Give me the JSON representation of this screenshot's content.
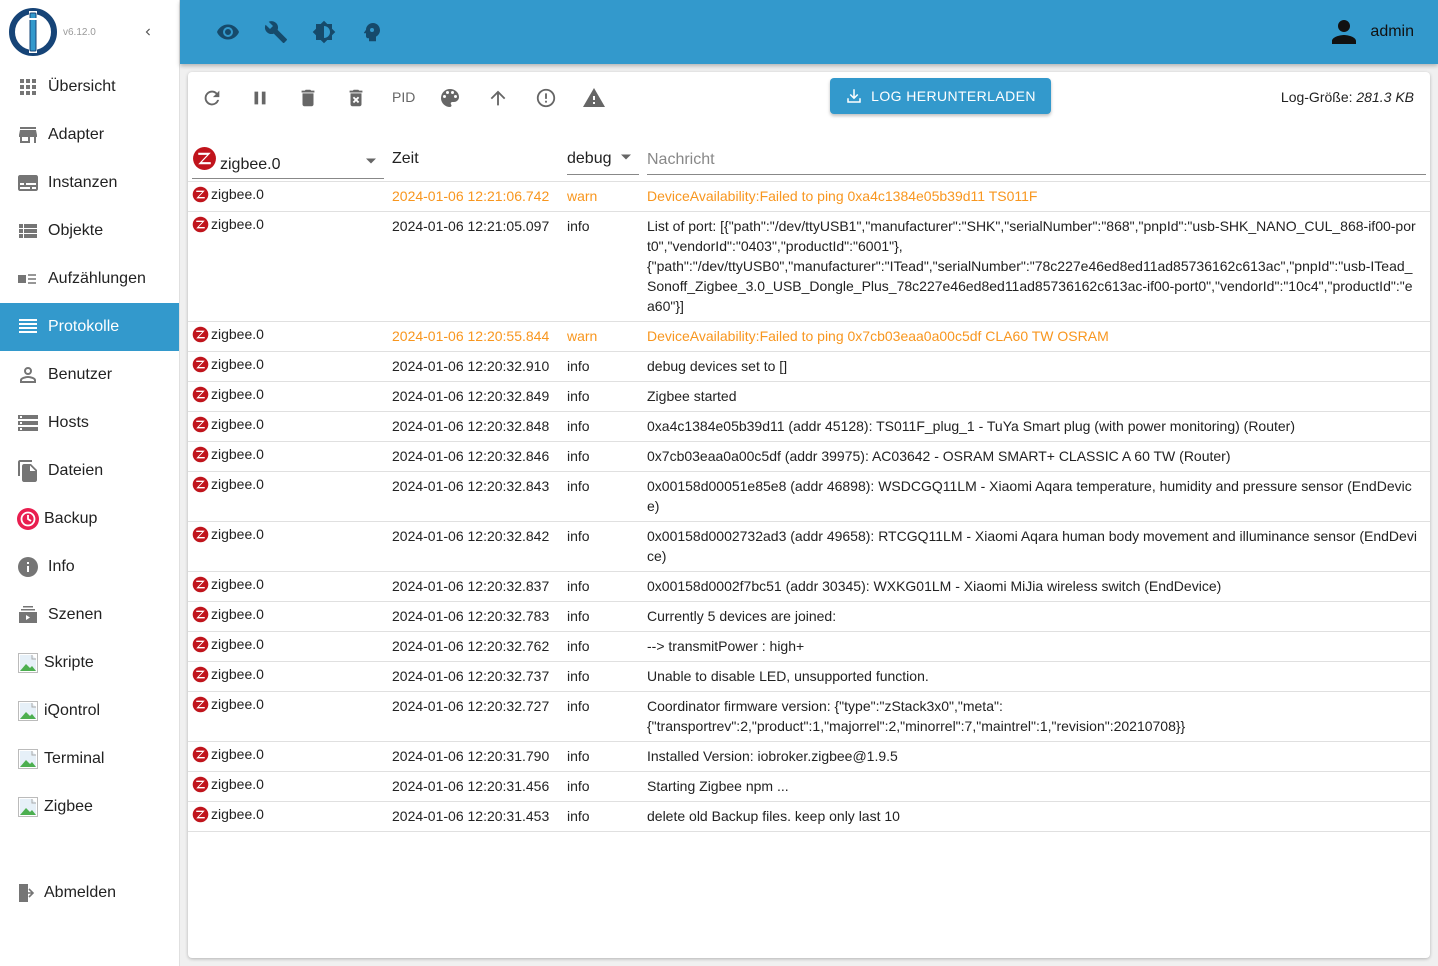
{
  "app": {
    "version": "v6.12.0",
    "user": "admin",
    "brand_color": "#3399cc"
  },
  "sidebar": {
    "items": [
      {
        "label": "Übersicht",
        "icon": "apps-grid-icon"
      },
      {
        "label": "Adapter",
        "icon": "store-icon"
      },
      {
        "label": "Instanzen",
        "icon": "subtitles-icon"
      },
      {
        "label": "Objekte",
        "icon": "list-icon"
      },
      {
        "label": "Aufzählungen",
        "icon": "enum-icon"
      },
      {
        "label": "Protokolle",
        "icon": "menu-lines-icon",
        "active": true
      },
      {
        "label": "Benutzer",
        "icon": "person-outline-icon"
      },
      {
        "label": "Hosts",
        "icon": "storage-icon"
      },
      {
        "label": "Dateien",
        "icon": "file-copy-icon"
      },
      {
        "label": "Backup",
        "icon": "backup-clock-icon"
      },
      {
        "label": "Info",
        "icon": "info-icon"
      },
      {
        "label": "Szenen",
        "icon": "scenes-icon"
      },
      {
        "label": "Skripte",
        "icon": "broken-image-icon"
      },
      {
        "label": "iQontrol",
        "icon": "broken-image-icon"
      },
      {
        "label": "Terminal",
        "icon": "broken-image-icon"
      },
      {
        "label": "Zigbee",
        "icon": "broken-image-icon"
      }
    ],
    "logout": {
      "label": "Abmelden",
      "icon": "logout-icon"
    }
  },
  "topbar": {
    "icons": [
      "eye-icon",
      "wrench-icon",
      "brightness-icon",
      "expert-mode-icon"
    ]
  },
  "toolbar": {
    "icons": [
      "refresh-icon",
      "pause-icon",
      "delete-icon",
      "delete-forever-icon",
      "pid",
      "palette-icon",
      "arrow-up-icon",
      "error-outline-icon",
      "warning-icon"
    ],
    "pid_label": "PID",
    "download_label": "LOG HERUNTERLADEN",
    "log_size_label": "Log-Größe:",
    "log_size_value": "281.3 KB"
  },
  "table": {
    "adapter_filter": "zigbee.0",
    "time_header": "Zeit",
    "level_filter": "debug",
    "message_placeholder": "Nachricht",
    "warn_color": "#f8961e",
    "rows": [
      {
        "source": "zigbee.0",
        "time": "2024-01-06 12:21:06.742",
        "level": "warn",
        "message": "DeviceAvailability:Failed to ping 0xa4c1384e05b39d11 TS011F"
      },
      {
        "source": "zigbee.0",
        "time": "2024-01-06 12:21:05.097",
        "level": "info",
        "message": "List of port: [{\"path\":\"/dev/ttyUSB1\",\"manufacturer\":\"SHK\",\"serialNumber\":\"868\",\"pnpId\":\"usb-SHK_NANO_CUL_868-if00-port0\",\"vendorId\":\"0403\",\"productId\":\"6001\"},\n{\"path\":\"/dev/ttyUSB0\",\"manufacturer\":\"ITead\",\"serialNumber\":\"78c227e46ed8ed11ad85736162c613ac\",\"pnpId\":\"usb-ITead_Sonoff_Zigbee_3.0_USB_Dongle_Plus_78c227e46ed8ed11ad85736162c613ac-if00-port0\",\"vendorId\":\"10c4\",\"productId\":\"ea60\"}]"
      },
      {
        "source": "zigbee.0",
        "time": "2024-01-06 12:20:55.844",
        "level": "warn",
        "message": "DeviceAvailability:Failed to ping 0x7cb03eaa0a00c5df CLA60 TW OSRAM"
      },
      {
        "source": "zigbee.0",
        "time": "2024-01-06 12:20:32.910",
        "level": "info",
        "message": "debug devices set to []"
      },
      {
        "source": "zigbee.0",
        "time": "2024-01-06 12:20:32.849",
        "level": "info",
        "message": "Zigbee started"
      },
      {
        "source": "zigbee.0",
        "time": "2024-01-06 12:20:32.848",
        "level": "info",
        "message": "0xa4c1384e05b39d11 (addr 45128): TS011F_plug_1 - TuYa Smart plug (with power monitoring) (Router)"
      },
      {
        "source": "zigbee.0",
        "time": "2024-01-06 12:20:32.846",
        "level": "info",
        "message": "0x7cb03eaa0a00c5df (addr 39975): AC03642 - OSRAM SMART+ CLASSIC A 60 TW (Router)"
      },
      {
        "source": "zigbee.0",
        "time": "2024-01-06 12:20:32.843",
        "level": "info",
        "message": "0x00158d00051e85e8 (addr 46898): WSDCGQ11LM - Xiaomi Aqara temperature, humidity and pressure sensor (EndDevice)"
      },
      {
        "source": "zigbee.0",
        "time": "2024-01-06 12:20:32.842",
        "level": "info",
        "message": "0x00158d0002732ad3 (addr 49658): RTCGQ11LM - Xiaomi Aqara human body movement and illuminance sensor (EndDevice)"
      },
      {
        "source": "zigbee.0",
        "time": "2024-01-06 12:20:32.837",
        "level": "info",
        "message": "0x00158d0002f7bc51 (addr 30345): WXKG01LM - Xiaomi MiJia wireless switch (EndDevice)"
      },
      {
        "source": "zigbee.0",
        "time": "2024-01-06 12:20:32.783",
        "level": "info",
        "message": "Currently 5 devices are joined:"
      },
      {
        "source": "zigbee.0",
        "time": "2024-01-06 12:20:32.762",
        "level": "info",
        "message": "--> transmitPower : high+"
      },
      {
        "source": "zigbee.0",
        "time": "2024-01-06 12:20:32.737",
        "level": "info",
        "message": "Unable to disable LED, unsupported function."
      },
      {
        "source": "zigbee.0",
        "time": "2024-01-06 12:20:32.727",
        "level": "info",
        "message": "Coordinator firmware version: {\"type\":\"zStack3x0\",\"meta\":\n{\"transportrev\":2,\"product\":1,\"majorrel\":2,\"minorrel\":7,\"maintrel\":1,\"revision\":20210708}}"
      },
      {
        "source": "zigbee.0",
        "time": "2024-01-06 12:20:31.790",
        "level": "info",
        "message": "Installed Version: iobroker.zigbee@1.9.5"
      },
      {
        "source": "zigbee.0",
        "time": "2024-01-06 12:20:31.456",
        "level": "info",
        "message": "Starting Zigbee npm ..."
      },
      {
        "source": "zigbee.0",
        "time": "2024-01-06 12:20:31.453",
        "level": "info",
        "message": "delete old Backup files. keep only last 10"
      }
    ]
  }
}
